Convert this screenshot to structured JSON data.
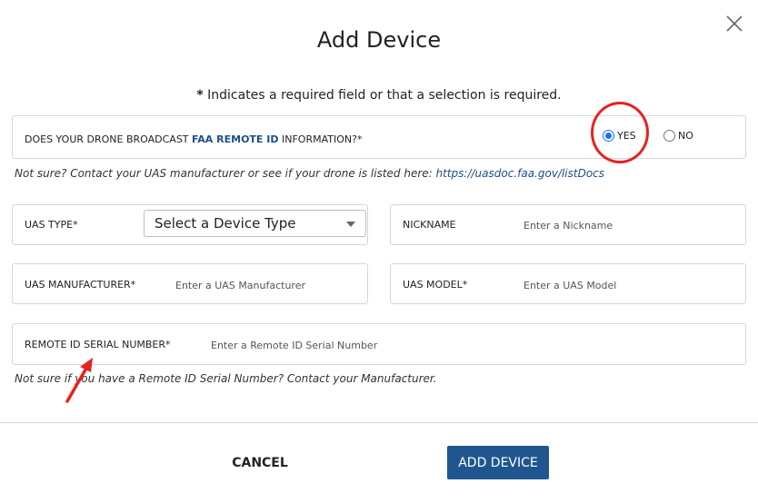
{
  "dialog": {
    "title": "Add Device",
    "close_icon": "close-icon",
    "required_note_marker": "*",
    "required_note": " Indicates a required field or that a selection is required."
  },
  "remote_id_question": {
    "label_prefix": "DOES YOUR DRONE BROADCAST ",
    "label_link": "FAA REMOTE ID",
    "label_suffix": " INFORMATION?*",
    "options": [
      {
        "label": "YES",
        "checked": true
      },
      {
        "label": "NO",
        "checked": false
      }
    ],
    "hint_text": "Not sure? Contact your UAS manufacturer or see if your drone is listed here: ",
    "hint_link": "https://uasdoc.faa.gov/listDocs"
  },
  "fields": {
    "uas_type": {
      "label": "UAS TYPE*",
      "selected": "Select a Device Type"
    },
    "nickname": {
      "label": "NICKNAME",
      "placeholder": "Enter a Nickname"
    },
    "uas_manufacturer": {
      "label": "UAS MANUFACTURER*",
      "placeholder": "Enter a UAS Manufacturer"
    },
    "uas_model": {
      "label": "UAS MODEL*",
      "placeholder": "Enter a UAS Model"
    },
    "remote_id_serial": {
      "label": "REMOTE ID SERIAL NUMBER*",
      "placeholder": "Enter a Remote ID Serial Number"
    }
  },
  "serial_hint": "Not sure if you have a Remote ID Serial Number? Contact your Manufacturer.",
  "footer": {
    "cancel_label": "CANCEL",
    "add_label": "ADD DEVICE"
  },
  "colors": {
    "accent": "#1f568f",
    "link": "#1f4e87",
    "annotation": "#e8211f"
  }
}
